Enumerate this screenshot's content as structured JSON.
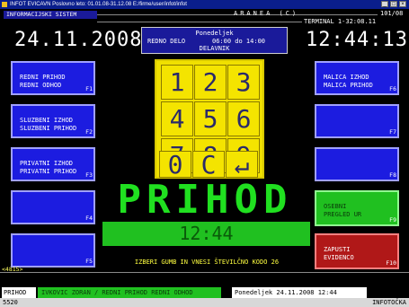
{
  "window": {
    "title": "INFOT EVICAVN  Poslovno leto: 01.01.08-31.12.08  E:/firme/user/infot/infot",
    "minimize": "_",
    "maximize": "□",
    "close": "×"
  },
  "header": {
    "system_label": "INFORMACIJSKI SISTEM",
    "brand": "ARANEA (C)",
    "page_code": "101/08",
    "terminal": "TERMINAL 1-32:08.11",
    "date": "24.11.2008",
    "time": "12:44:13"
  },
  "infobox": {
    "day": "Ponedeljek",
    "schedule_label": "REDNO DELO",
    "schedule_time": "06:00 do 14:00",
    "day_type": "DELAVNIK"
  },
  "left_buttons": [
    {
      "line1": "REDNI PRIHOD",
      "line2": "REDNI ODHOD",
      "fkey": "F1"
    },
    {
      "line1": "SLUZBENI IZHOD",
      "line2": "SLUZBENI PRIHOD",
      "fkey": "F2"
    },
    {
      "line1": "PRIVATNI IZHOD",
      "line2": "PRIVATNI PRIHOD",
      "fkey": "F3"
    },
    {
      "line1": "",
      "line2": "",
      "fkey": "F4"
    },
    {
      "line1": "",
      "line2": "",
      "fkey": "F5"
    }
  ],
  "right_buttons": [
    {
      "line1": "MALICA IZHOD",
      "line2": "MALICA PRIHOD",
      "fkey": "F6"
    },
    {
      "line1": "",
      "line2": "",
      "fkey": "F7"
    },
    {
      "line1": "",
      "line2": "",
      "fkey": "F8"
    },
    {
      "line1": "OSEBNI",
      "line2": "PREGLED UR",
      "fkey": "F9"
    },
    {
      "line1": "ZAPUSTI",
      "line2": "EVIDENCO",
      "fkey": "F10"
    }
  ],
  "keypad": [
    "1",
    "2",
    "3",
    "4",
    "5",
    "6",
    "7",
    "8",
    "9",
    "0",
    "C",
    "↵"
  ],
  "mode_word": "PRIHOD",
  "current_time": "12:44",
  "instruction": "IZBERI GUMB IN VNESI ŠTEVILČNO KODO 26",
  "session_id": "<4815>",
  "footer": {
    "mode": "PRIHOD",
    "employee": "IVKOVIC ZORAN / REDNI PRIHOD REDNI ODHOD",
    "datetime": "Ponedeljek 24.11.2008 12:44",
    "code": "5520",
    "brand": "INFOTOČKA"
  },
  "colors": {
    "background": "#000000",
    "button_blue": "#1c1ce0",
    "keypad_yellow": "#f0e000",
    "accent_green": "#20e020",
    "exit_red": "#b01818"
  }
}
